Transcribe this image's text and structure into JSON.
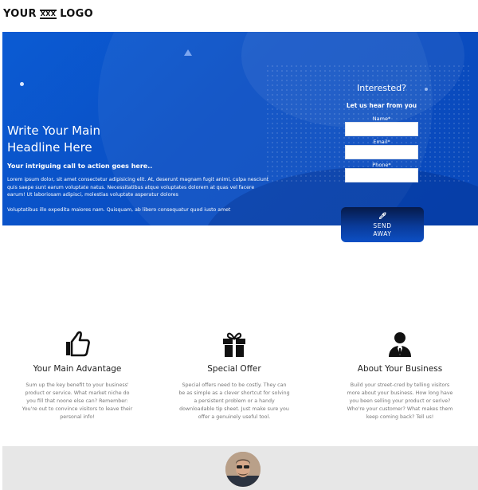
{
  "header": {
    "logo_left": "YOUR",
    "logo_mid": "XXX",
    "logo_right": "LOGO"
  },
  "hero": {
    "headline_line1": "Write Your Main",
    "headline_line2": "Headline Here",
    "cta": "Your intriguing call to action goes here..",
    "paragraph1": "Lorem ipsum dolor, sit amet consectetur adipisicing elit. At, deserunt magnam fugit animi, culpa nesciunt quis saepe sunt earum voluptate natus. Necessitatibus atque voluptates dolorem at quas vel facere earum! Ut laboriosam adipisci, molestias voluptate asperatur dolores",
    "paragraph2": "Voluptatibus illo expedita maiores nam. Quisquam, ab libero consequatur quod iusto amet"
  },
  "form": {
    "title": "Interested?",
    "subtitle": "Let us hear from you",
    "name_label": "Name*",
    "email_label": "Email*",
    "phone_label": "Phone*",
    "send_label": "SEND AWAY"
  },
  "features": [
    {
      "icon": "thumbs-up-icon",
      "title": "Your Main Advantage",
      "text": "Sum up the key benefit to your business' product or service. What market niche do you fill that noone else can? Remember: You're out to convince visitors to leave their personal info!"
    },
    {
      "icon": "gift-icon",
      "title": "Special Offer",
      "text": "Special offers need to be costly. They can be as simple as a clever shortcut for solving a persistent problem or a handy downloadable tip sheet. Just make sure you offer a genuinely useful tool."
    },
    {
      "icon": "person-tie-icon",
      "title": "About Your Business",
      "text": "Build your street-cred by telling visitors more about your business. How long have you been selling your product or serive? Who're your customer? What makes them keep coming back? Tell us!"
    }
  ],
  "colors": {
    "hero_blue": "#0b5bd3",
    "button_dark": "#061a4a",
    "bottom_band": "#e7e7e7"
  }
}
